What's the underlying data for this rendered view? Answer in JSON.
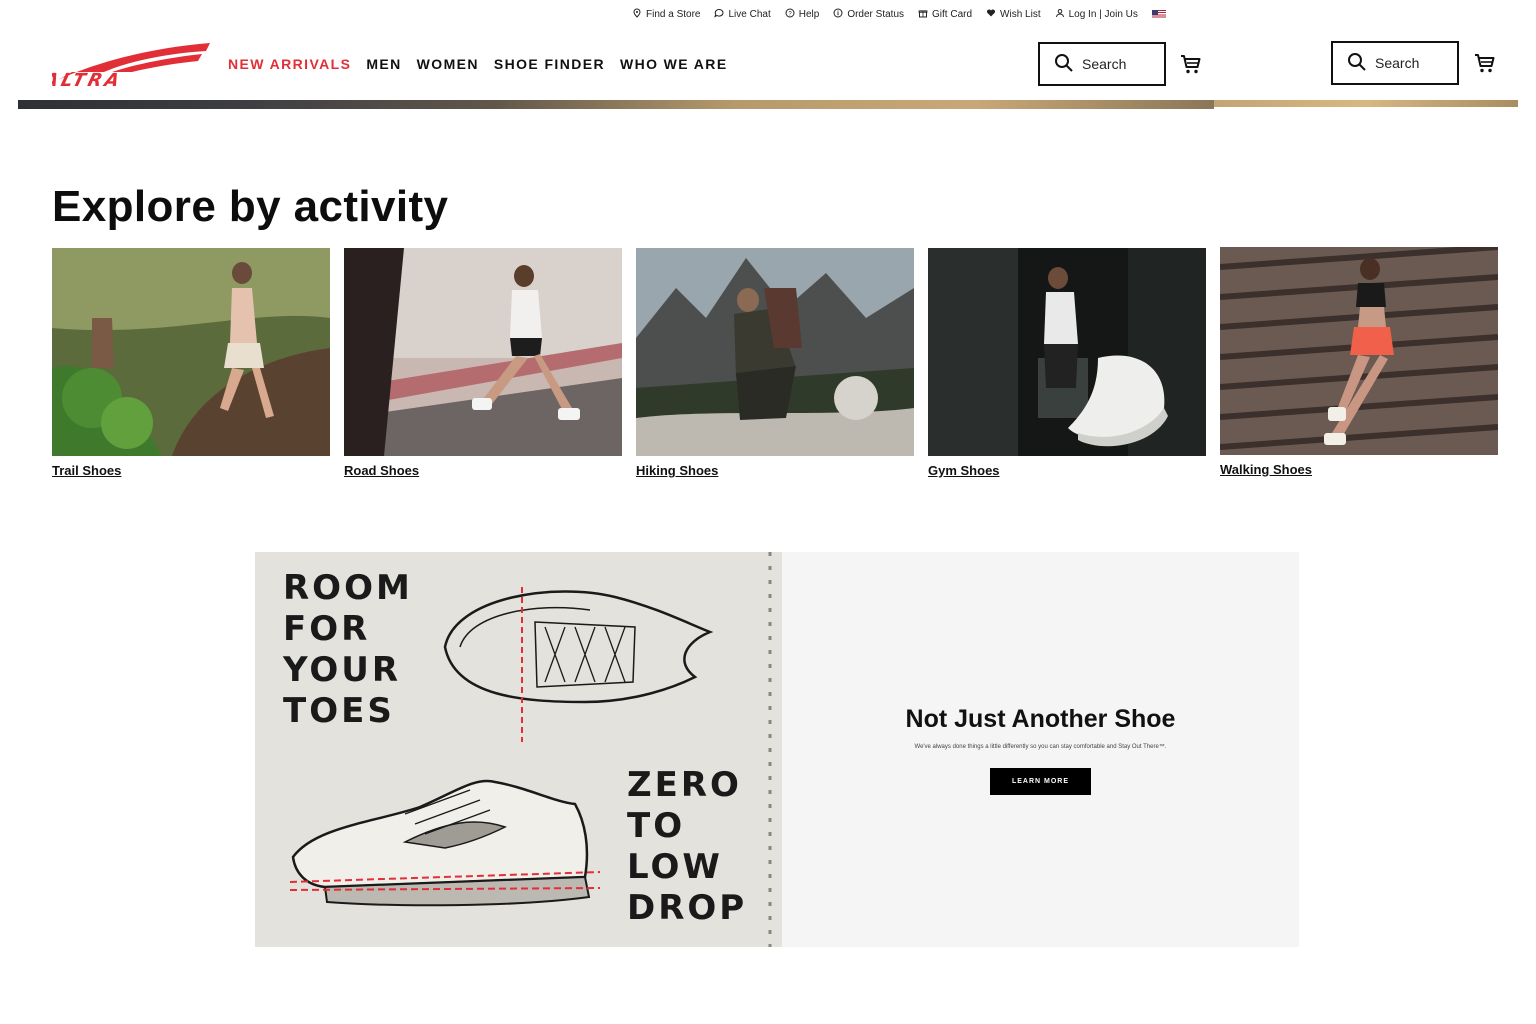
{
  "utility_bar": {
    "items": [
      {
        "label": "Find a Store",
        "icon": "pin-icon"
      },
      {
        "label": "Live Chat",
        "icon": "chat-icon"
      },
      {
        "label": "Help",
        "icon": "help-icon"
      },
      {
        "label": "Order Status",
        "icon": "info-icon"
      },
      {
        "label": "Gift Card",
        "icon": "gift-icon"
      },
      {
        "label": "Wish List",
        "icon": "heart-icon"
      },
      {
        "label": "Log In | Join Us",
        "icon": "user-icon"
      }
    ],
    "region_flag": "us-flag-icon"
  },
  "header": {
    "brand": "ALTRA",
    "nav": [
      "NEW ARRIVALS",
      "MEN",
      "WOMEN",
      "SHOE FINDER",
      "WHO WE ARE"
    ],
    "search_label": "Search",
    "accent_color": "#e22f37"
  },
  "explore": {
    "title": "Explore by activity",
    "cards": [
      {
        "label": "Trail Shoes"
      },
      {
        "label": "Road Shoes"
      },
      {
        "label": "Hiking Shoes"
      },
      {
        "label": "Gym Shoes"
      },
      {
        "label": "Walking Shoes"
      }
    ]
  },
  "feature": {
    "left_top_words": [
      "ROOM",
      "FOR",
      "YOUR",
      "TOES"
    ],
    "left_bottom_words": [
      "ZERO",
      "TO",
      "LOW",
      "DROP"
    ],
    "heading": "Not Just Another Shoe",
    "subtext": "We've always done things a little differently so you can stay comfortable and Stay Out There™.",
    "button_label": "LEARN MORE"
  }
}
